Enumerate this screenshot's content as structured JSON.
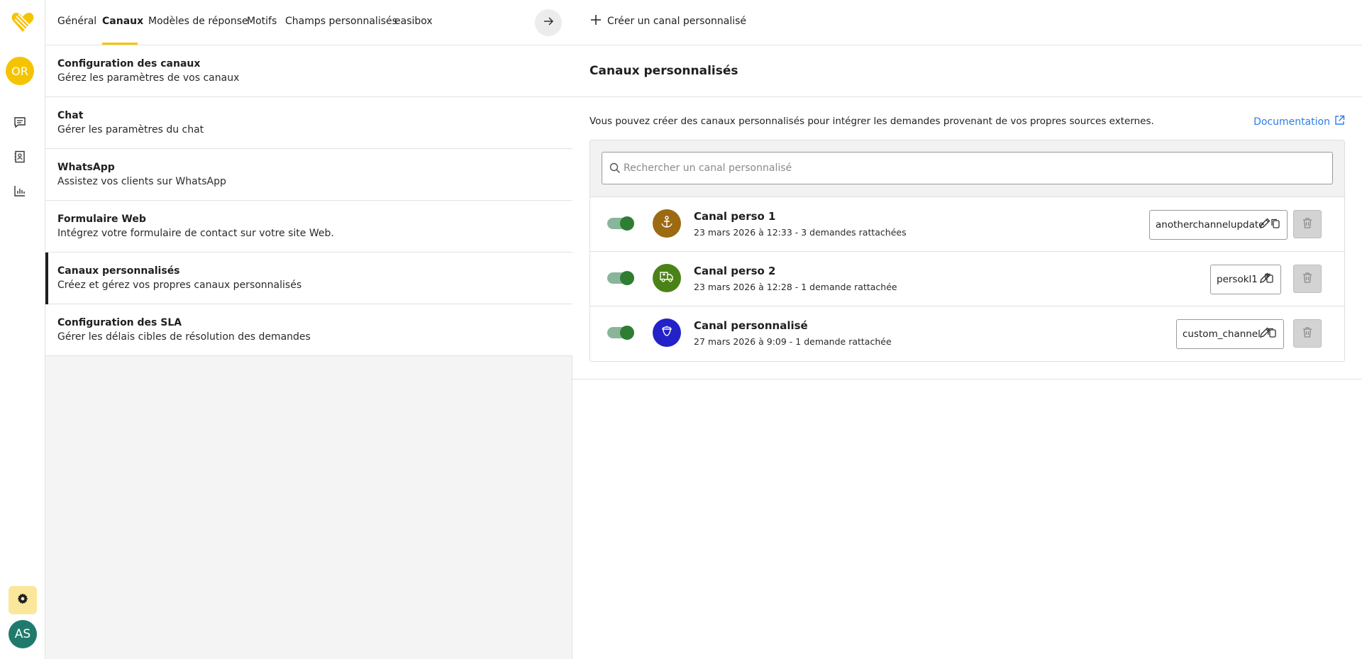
{
  "rail": {
    "user_initials": "OR",
    "me_initials": "AS",
    "icons": [
      "brand-logo",
      "chat-icon",
      "contacts-icon",
      "stats-icon",
      "gear-icon"
    ]
  },
  "tabs": [
    {
      "label": "Général",
      "active": false
    },
    {
      "label": "Canaux",
      "active": true
    },
    {
      "label": "Modèles de réponse",
      "active": false
    },
    {
      "label": "Motifs",
      "active": false
    },
    {
      "label": "Champs personnalisés",
      "active": false
    },
    {
      "label": "easibox",
      "active": false
    }
  ],
  "menu": [
    {
      "title": "Configuration des canaux",
      "subtitle": "Gérez les paramètres de vos canaux",
      "active": false
    },
    {
      "title": "Chat",
      "subtitle": "Gérer les paramètres du chat",
      "active": false
    },
    {
      "title": "WhatsApp",
      "subtitle": "Assistez vos clients sur WhatsApp",
      "active": false
    },
    {
      "title": "Formulaire Web",
      "subtitle": "Intégrez votre formulaire de contact sur votre site Web.",
      "active": false
    },
    {
      "title": "Canaux personnalisés",
      "subtitle": "Créez et gérez vos propres canaux personnalisés",
      "active": true
    },
    {
      "title": "Configuration des SLA",
      "subtitle": "Gérer les délais cibles de résolution des demandes",
      "active": false
    }
  ],
  "right": {
    "create_label": "Créer un canal personnalisé",
    "section_title": "Canaux personnalisés",
    "description": "Vous pouvez créer des canaux personnalisés pour intégrer les demandes provenant de vos propres sources externes.",
    "doc_label": "Documentation",
    "search_placeholder": "Rechercher un canal personnalisé",
    "channels": [
      {
        "name": "Canal perso 1",
        "meta": "23 mars 2026 à 12:33 - 3 demandes rattachées",
        "code": "anotherchannelupdate",
        "enabled": true,
        "avatar_color": "#9b6a12",
        "icon": "anchor-icon"
      },
      {
        "name": "Canal perso 2",
        "meta": "23 mars 2026 à 12:28 - 1 demande rattachée",
        "code": "persokl1",
        "enabled": true,
        "avatar_color": "#4b8217",
        "icon": "delivery-truck-icon"
      },
      {
        "name": "Canal personnalisé",
        "meta": "27 mars 2026 à 9:09 - 1 demande rattachée",
        "code": "custom_channel",
        "enabled": true,
        "avatar_color": "#2222c8",
        "icon": "acorn-icon"
      }
    ]
  },
  "colors": {
    "accent": "#f5c400",
    "link": "#2b7de9",
    "toggle_on": "#2e7d32"
  }
}
